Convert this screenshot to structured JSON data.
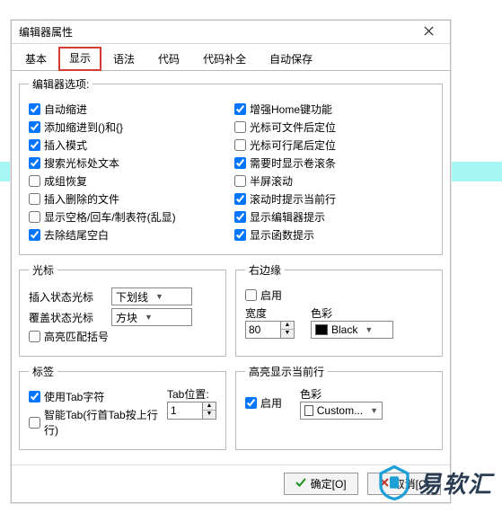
{
  "title": "编辑器属性",
  "tabs": [
    "基本",
    "显示",
    "语法",
    "代码",
    "代码补全",
    "自动保存"
  ],
  "active_tab": 1,
  "highlight_tab": 1,
  "group_editor_opts": {
    "legend": "编辑器选项:",
    "left": [
      {
        "label": "自动缩进",
        "checked": true
      },
      {
        "label": "添加缩进到()和{}",
        "checked": true
      },
      {
        "label": "插入模式",
        "checked": true
      },
      {
        "label": "搜索光标处文本",
        "checked": true
      },
      {
        "label": "成组恢复",
        "checked": false
      },
      {
        "label": "插入删除的文件",
        "checked": false
      },
      {
        "label": "显示空格/回车/制表符(乱显)",
        "checked": false
      },
      {
        "label": "去除结尾空白",
        "checked": true
      }
    ],
    "right": [
      {
        "label": "增强Home键功能",
        "checked": true
      },
      {
        "label": "光标可文件后定位",
        "checked": false
      },
      {
        "label": "光标可行尾后定位",
        "checked": false
      },
      {
        "label": "需要时显示卷滚条",
        "checked": true
      },
      {
        "label": "半屏滚动",
        "checked": false
      },
      {
        "label": "滚动时提示当前行",
        "checked": true
      },
      {
        "label": "显示编辑器提示",
        "checked": true
      },
      {
        "label": "显示函数提示",
        "checked": true
      }
    ]
  },
  "group_cursor": {
    "legend": "光标",
    "insert_label": "插入状态光标",
    "insert_value": "下划线",
    "over_label": "覆盖状态光标",
    "over_value": "方块",
    "hl_brackets": {
      "label": "高亮匹配括号",
      "checked": false
    }
  },
  "group_rightedge": {
    "legend": "右边缘",
    "enable": {
      "label": "启用",
      "checked": false
    },
    "width_label": "宽度",
    "width_value": "80",
    "color_label": "色彩",
    "color_value": "Black",
    "color_hex": "#000000"
  },
  "group_tab": {
    "legend": "标签",
    "usetab": {
      "label": "使用Tab字符",
      "checked": true
    },
    "smart": {
      "label": "智能Tab(行首Tab按上行行)",
      "checked": false
    },
    "tabpos_label": "Tab位置:",
    "tabpos_value": "1"
  },
  "group_hlrow": {
    "legend": "高亮显示当前行",
    "enable": {
      "label": "启用",
      "checked": true
    },
    "color_label": "色彩",
    "color_value": "Custom...",
    "color_hex": "#ffffff"
  },
  "buttons": {
    "ok": "确定[O]",
    "cancel": "取消[C]"
  },
  "watermark": "易软汇"
}
